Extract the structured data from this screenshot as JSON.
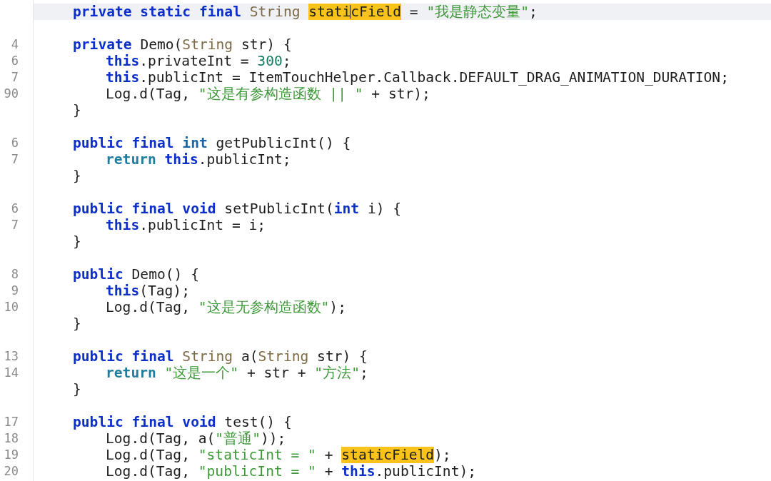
{
  "editor": {
    "lines": [
      {
        "kind": "code",
        "current": true,
        "tokens": [
          {
            "kind": "kw",
            "text": "private static final "
          },
          {
            "kind": "type",
            "text": "String "
          },
          {
            "kind": "match",
            "text": "stati",
            "caret": true
          },
          {
            "kind": "match",
            "text": "cField"
          },
          {
            "kind": "text",
            "text": " = "
          },
          {
            "kind": "str",
            "text": "\"我是静态变量\""
          },
          {
            "kind": "text",
            "text": ";"
          }
        ]
      },
      {
        "kind": "blank",
        "current": false
      },
      {
        "kind": "code",
        "number": "4",
        "current": false,
        "tokens": [
          {
            "kind": "kw",
            "text": "private "
          },
          {
            "kind": "text",
            "text": "Demo("
          },
          {
            "kind": "type",
            "text": "String"
          },
          {
            "kind": "text",
            "text": " str) {"
          }
        ],
        "children": [
          {
            "kind": "code",
            "number": "6",
            "current": false,
            "tokens": [
              {
                "kind": "kw",
                "text": "this"
              },
              {
                "kind": "text",
                "text": ".privateInt = "
              },
              {
                "kind": "num",
                "text": "300"
              },
              {
                "kind": "text",
                "text": ";"
              }
            ]
          },
          {
            "kind": "code",
            "number": "7",
            "current": false,
            "tokens": [
              {
                "kind": "kw",
                "text": "this"
              },
              {
                "kind": "text",
                "text": ".publicInt = ItemTouchHelper.Callback.DEFAULT_DRAG_ANIMATION_DURATION;"
              }
            ]
          },
          {
            "kind": "code",
            "number": "90",
            "current": false,
            "tokens": [
              {
                "kind": "text",
                "text": "Log.d(Tag, "
              },
              {
                "kind": "str",
                "text": "\"这是有参构造函数 || \""
              },
              {
                "kind": "text",
                "text": " + str);"
              }
            ]
          }
        ]
      },
      {
        "kind": "code",
        "current": false,
        "tokens": [
          {
            "kind": "text",
            "text": "}"
          }
        ]
      },
      {
        "kind": "blank",
        "current": false
      },
      {
        "kind": "code",
        "number": "6",
        "current": false,
        "tokens": [
          {
            "kind": "kw",
            "text": "public final "
          },
          {
            "kind": "prim",
            "text": "int"
          },
          {
            "kind": "text",
            "text": " getPublicInt() {"
          }
        ],
        "children": [
          {
            "kind": "code",
            "number": "7",
            "current": false,
            "tokens": [
              {
                "kind": "ret",
                "text": "return "
              },
              {
                "kind": "kw",
                "text": "this"
              },
              {
                "kind": "text",
                "text": ".publicInt;"
              }
            ]
          }
        ]
      },
      {
        "kind": "code",
        "current": false,
        "tokens": [
          {
            "kind": "text",
            "text": "}"
          }
        ]
      },
      {
        "kind": "blank",
        "current": false
      },
      {
        "kind": "code",
        "number": "6",
        "current": false,
        "tokens": [
          {
            "kind": "kw",
            "text": "public final void "
          },
          {
            "kind": "text",
            "text": "setPublicInt("
          },
          {
            "kind": "kw",
            "text": "int"
          },
          {
            "kind": "text",
            "text": " i) {"
          }
        ],
        "children": [
          {
            "kind": "code",
            "number": "7",
            "current": false,
            "tokens": [
              {
                "kind": "kw",
                "text": "this"
              },
              {
                "kind": "text",
                "text": ".publicInt = i;"
              }
            ]
          }
        ]
      },
      {
        "kind": "code",
        "current": false,
        "tokens": [
          {
            "kind": "text",
            "text": "}"
          }
        ]
      },
      {
        "kind": "blank",
        "current": false
      },
      {
        "kind": "code",
        "number": "8",
        "current": false,
        "tokens": [
          {
            "kind": "kw",
            "text": "public "
          },
          {
            "kind": "text",
            "text": "Demo() {"
          }
        ],
        "children": [
          {
            "kind": "code",
            "number": "9",
            "current": false,
            "tokens": [
              {
                "kind": "kw",
                "text": "this"
              },
              {
                "kind": "text",
                "text": "(Tag);"
              }
            ]
          },
          {
            "kind": "code",
            "number": "10",
            "current": false,
            "tokens": [
              {
                "kind": "text",
                "text": "Log.d(Tag, "
              },
              {
                "kind": "str",
                "text": "\"这是无参构造函数\""
              },
              {
                "kind": "text",
                "text": ");"
              }
            ]
          }
        ]
      },
      {
        "kind": "code",
        "current": false,
        "tokens": [
          {
            "kind": "text",
            "text": "}"
          }
        ]
      },
      {
        "kind": "blank",
        "current": false
      },
      {
        "kind": "code",
        "number": "13",
        "current": false,
        "tokens": [
          {
            "kind": "kw",
            "text": "public final "
          },
          {
            "kind": "type",
            "text": "String "
          },
          {
            "kind": "text",
            "text": "a("
          },
          {
            "kind": "type",
            "text": "String"
          },
          {
            "kind": "text",
            "text": " str) {"
          }
        ],
        "children": [
          {
            "kind": "code",
            "number": "14",
            "current": false,
            "tokens": [
              {
                "kind": "ret",
                "text": "return "
              },
              {
                "kind": "str",
                "text": "\"这是一个\""
              },
              {
                "kind": "text",
                "text": " + str + "
              },
              {
                "kind": "str",
                "text": "\"方法\""
              },
              {
                "kind": "text",
                "text": ";"
              }
            ]
          }
        ]
      },
      {
        "kind": "code",
        "current": false,
        "tokens": [
          {
            "kind": "text",
            "text": "}"
          }
        ]
      },
      {
        "kind": "blank",
        "current": false
      },
      {
        "kind": "code",
        "number": "17",
        "current": false,
        "tokens": [
          {
            "kind": "kw",
            "text": "public final void "
          },
          {
            "kind": "text",
            "text": "test() {"
          }
        ],
        "children": [
          {
            "kind": "code",
            "number": "18",
            "current": false,
            "tokens": [
              {
                "kind": "text",
                "text": "Log.d(Tag, a("
              },
              {
                "kind": "str",
                "text": "\"普通\""
              },
              {
                "kind": "text",
                "text": "));"
              }
            ]
          },
          {
            "kind": "code",
            "number": "19",
            "current": false,
            "tokens": [
              {
                "kind": "text",
                "text": "Log.d(Tag, "
              },
              {
                "kind": "str",
                "text": "\"staticInt = \""
              },
              {
                "kind": "text",
                "text": " + "
              },
              {
                "kind": "match",
                "text": "staticField"
              },
              {
                "kind": "text",
                "text": ");"
              }
            ]
          },
          {
            "kind": "code",
            "number": "20",
            "current": false,
            "tokens": [
              {
                "kind": "text",
                "text": "Log.d(Tag, "
              },
              {
                "kind": "str",
                "text": "\"publicInt = \""
              },
              {
                "kind": "text",
                "text": " + "
              },
              {
                "kind": "kw",
                "text": "this"
              },
              {
                "kind": "text",
                "text": ".publicInt);"
              }
            ]
          }
        ]
      }
    ]
  }
}
